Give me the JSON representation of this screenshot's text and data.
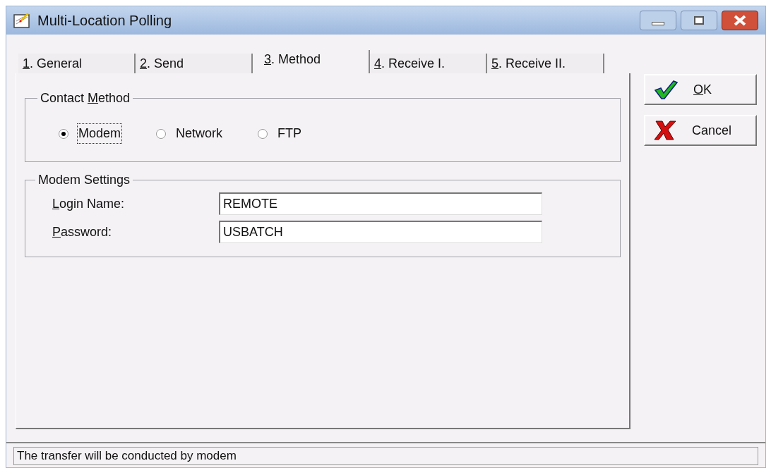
{
  "window": {
    "title": "Multi-Location Polling"
  },
  "tabs": [
    {
      "label": {
        "accel": "1",
        "post": ". General"
      },
      "selected": false
    },
    {
      "label": {
        "accel": "2",
        "post": ". Send"
      },
      "selected": false
    },
    {
      "label": {
        "accel": "3",
        "post": ". Method"
      },
      "selected": true
    },
    {
      "label": {
        "accel": "4",
        "post": ". Receive I."
      },
      "selected": false
    },
    {
      "label": {
        "accel": "5",
        "post": ". Receive II."
      },
      "selected": false
    }
  ],
  "contact_method": {
    "title": {
      "pre": "Contact ",
      "accel": "M",
      "post": "ethod"
    },
    "options": [
      {
        "label": "Modem",
        "selected": true,
        "focused": true
      },
      {
        "label": "Network",
        "selected": false,
        "focused": false
      },
      {
        "label": "FTP",
        "selected": false,
        "focused": false
      }
    ]
  },
  "modem_settings": {
    "title": "Modem Settings",
    "fields": [
      {
        "label": {
          "accel": "L",
          "post": "ogin Name:"
        },
        "value": "REMOTE"
      },
      {
        "label": {
          "accel": "P",
          "post": "assword:"
        },
        "value": "USBATCH"
      }
    ]
  },
  "buttons": [
    {
      "kind": "ok",
      "label": {
        "accel": "O",
        "post": "K"
      }
    },
    {
      "kind": "cancel",
      "label": {
        "pre": "Cancel"
      }
    }
  ],
  "status_bar": "The transfer will be conducted by modem"
}
